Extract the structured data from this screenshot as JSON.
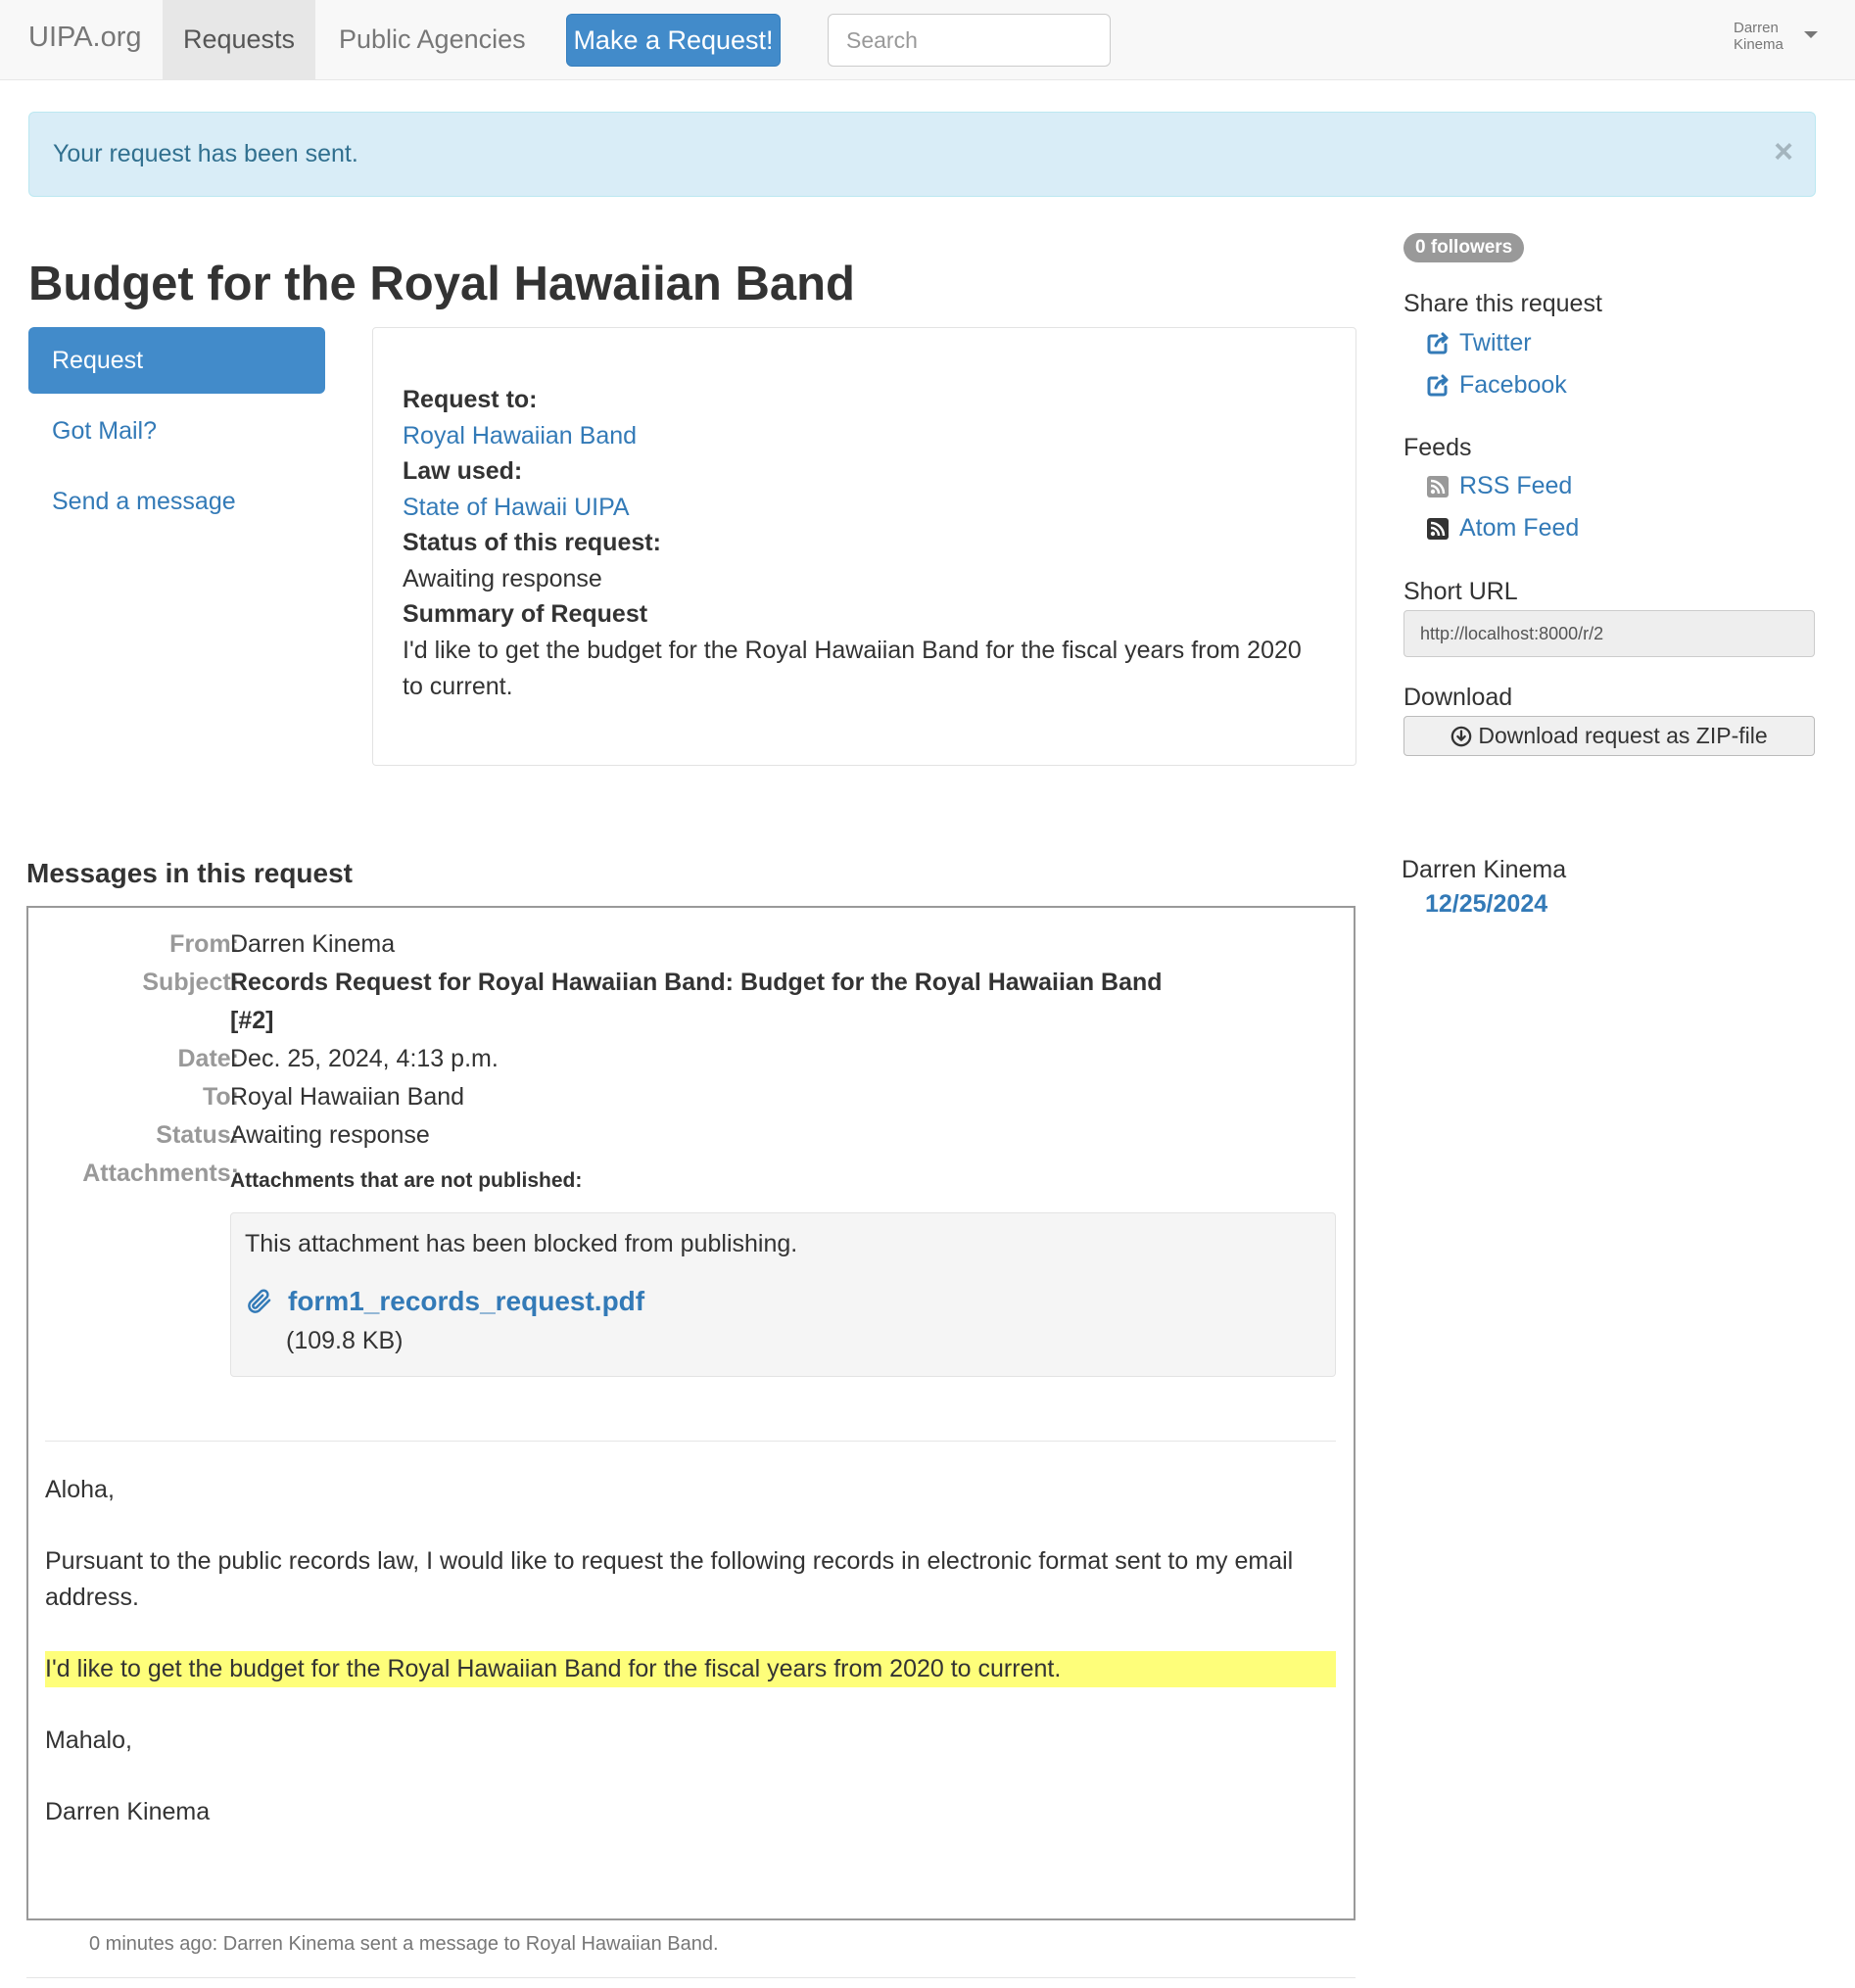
{
  "nav": {
    "brand": "UIPA.org",
    "requests": "Requests",
    "agencies": "Public Agencies",
    "make_request": "Make a Request!",
    "search_placeholder": "Search",
    "user_first": "Darren",
    "user_last": "Kinema"
  },
  "alert": {
    "text": "Your request has been sent.",
    "close": "×"
  },
  "title": "Budget for the Royal Hawaiian Band",
  "pills": {
    "request": "Request",
    "got_mail": "Got Mail?",
    "send_message": "Send a message"
  },
  "request": {
    "to_label": "Request to:",
    "to_value": "Royal Hawaiian Band",
    "law_label": "Law used:",
    "law_value": "State of Hawaii UIPA",
    "status_label": "Status of this request:",
    "status_value": "Awaiting response",
    "summary_label": "Summary of Request",
    "summary_value": "I'd like to get the budget for the Royal Hawaiian Band for the fiscal years from 2020 to current."
  },
  "sidebar": {
    "followers": "0 followers",
    "share_heading": "Share this request",
    "twitter": "Twitter",
    "facebook": "Facebook",
    "feeds_heading": "Feeds",
    "rss": "RSS Feed",
    "atom": "Atom Feed",
    "short_url_heading": "Short URL",
    "short_url": "http://localhost:8000/r/2",
    "download_heading": "Download",
    "download_button": "Download request as ZIP-file",
    "sender": "Darren Kinema",
    "date": "12/25/2024"
  },
  "messages": {
    "heading": "Messages in this request",
    "from_label": "From:",
    "from_value": "Darren Kinema",
    "subject_label": "Subject:",
    "subject_value": "Records Request for Royal Hawaiian Band: Budget for the Royal Hawaiian Band [#2]",
    "date_label": "Date:",
    "date_value": "Dec. 25, 2024, 4:13 p.m.",
    "to_label": "To:",
    "to_value": "Royal Hawaiian Band",
    "status_label": "Status:",
    "status_value": "Awaiting response",
    "attachments_label": "Attachments:",
    "attachments_note": "Attachments that are not published:",
    "blocked_text": "This attachment has been blocked from publishing.",
    "file_name": "form1_records_request.pdf",
    "file_size": "(109.8 KB)",
    "body_greeting": "Aloha,",
    "body_p1": "Pursuant to the public records law, I would like to request the following records in electronic format sent to my email address.",
    "body_highlight": "I'd like to get the budget for the Royal Hawaiian Band for the fiscal years from 2020 to current.",
    "body_closing": "Mahalo,",
    "body_signature": "Darren Kinema",
    "footer_note": "0 minutes ago: Darren Kinema sent a message to Royal Hawaiian Band."
  },
  "colors": {
    "primary": "#428bca",
    "link": "#337ab7",
    "alert_bg": "#d9edf7",
    "highlight": "#fefe7a"
  }
}
